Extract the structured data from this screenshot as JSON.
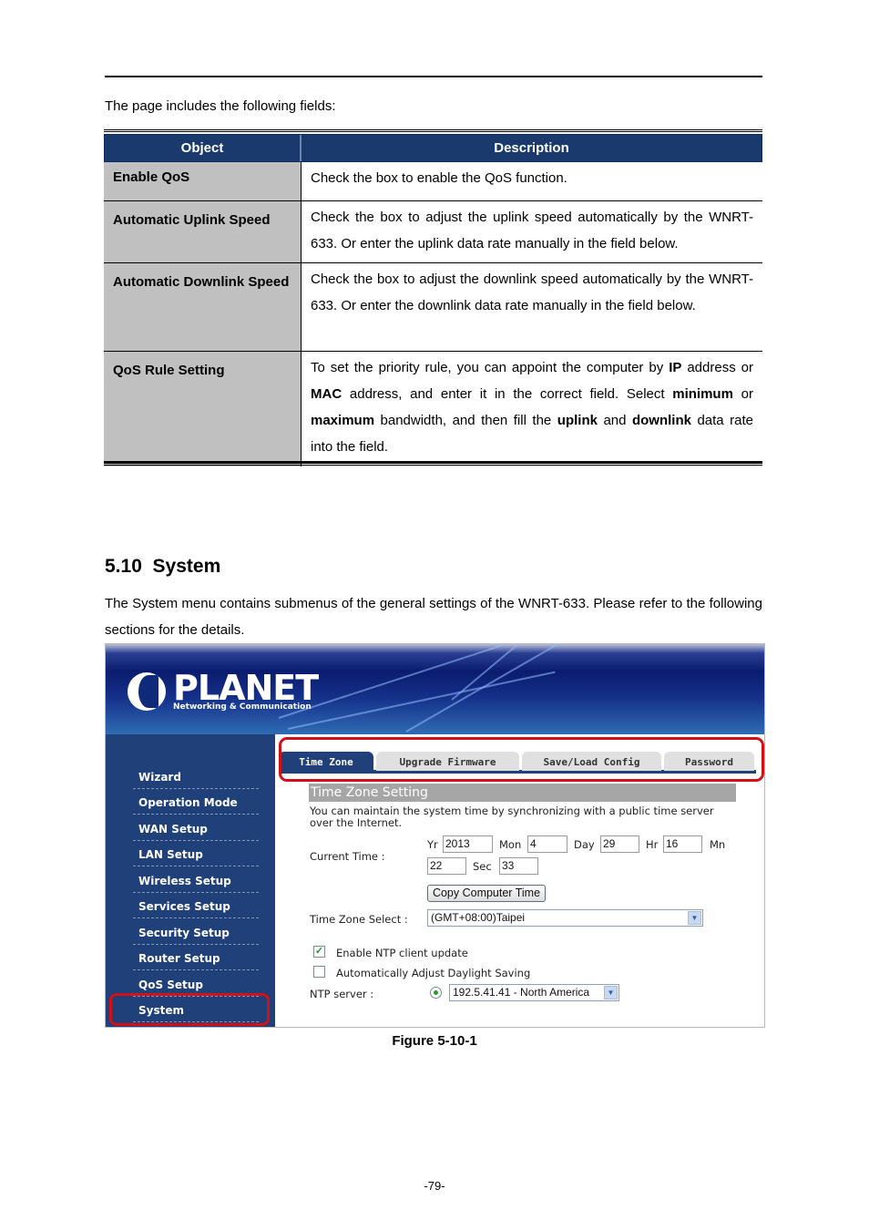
{
  "intro": "The page includes the following fields:",
  "table": {
    "headers": {
      "object": "Object",
      "description": "Description"
    },
    "rows": [
      {
        "object": "Enable QoS",
        "description": "Check the box to enable the QoS function."
      },
      {
        "object": "Automatic Uplink Speed",
        "description": "Check the box to adjust the uplink speed automatically by the WNRT-633. Or enter the uplink data rate manually in the field below."
      },
      {
        "object": "Automatic Downlink Speed",
        "description": "Check the box to adjust the downlink speed automatically by the WNRT-633. Or enter the downlink data rate manually in the field below."
      },
      {
        "object": "QoS Rule Setting",
        "description_parts": {
          "p1": "To set the priority rule, you can appoint the computer by ",
          "b1": "IP",
          "p2": " address or ",
          "b2": "MAC",
          "p3": " address, and enter it in the correct field. Select ",
          "b3": "minimum",
          "p4": " or ",
          "b4": "maximum",
          "p5": " bandwidth, and then fill the ",
          "b5": "uplink",
          "p6": " and ",
          "b6": "downlink",
          "p7": " data rate into the field."
        }
      }
    ]
  },
  "section": {
    "title": "5.10  System",
    "paragraph": "The System menu contains submenus of the general settings of the WNRT-633. Please refer to the following sections for the details."
  },
  "screenshot": {
    "logo": {
      "brand": "PLANET",
      "tagline": "Networking & Communication"
    },
    "sidebar": {
      "items": [
        "Wizard",
        "Operation Mode",
        "WAN Setup",
        "LAN Setup",
        "Wireless Setup",
        "Services Setup",
        "Security Setup",
        "Router Setup",
        "QoS Setup",
        "System"
      ],
      "active": "System"
    },
    "tabs": [
      "Time Zone",
      "Upgrade Firmware",
      "Save/Load Config",
      "Password"
    ],
    "active_tab": "Time Zone",
    "panel": {
      "title": "Time Zone Setting",
      "description": "You can maintain the system time by synchronizing with a public time server over the Internet.",
      "current_time_label": "Current Time :",
      "labels": {
        "yr": "Yr",
        "mon": "Mon",
        "day": "Day",
        "hr": "Hr",
        "mn": "Mn",
        "sec": "Sec"
      },
      "values": {
        "yr": "2013",
        "mon": "4",
        "day": "29",
        "hr": "16",
        "mn": "22",
        "sec": "33"
      },
      "copy_button": "Copy Computer Time",
      "timezone_label": "Time Zone Select :",
      "timezone_value": "(GMT+08:00)Taipei",
      "ntp_enable_label": "Enable NTP client update",
      "ntp_enable_checked": true,
      "daylight_label": "Automatically Adjust Daylight Saving",
      "daylight_checked": false,
      "ntp_server_label": "NTP server :",
      "ntp_server_value": "192.5.41.41 - North America"
    },
    "highlight_color": "#d2101a",
    "nav_color": "#1f4078"
  },
  "figure_caption": "Figure 5-10-1",
  "page_number": "-79-"
}
